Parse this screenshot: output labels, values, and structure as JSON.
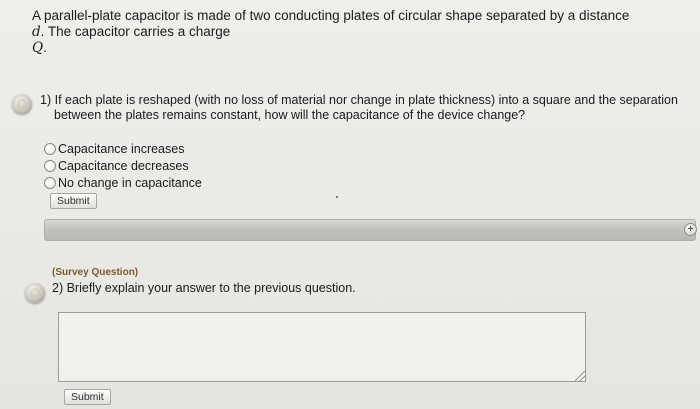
{
  "intro": {
    "line1": "A parallel-plate capacitor is made of two conducting plates of circular shape separated by a distance",
    "var_d": "d",
    "line2_rest": ". The capacitor carries a charge",
    "var_Q": "Q",
    "period": "."
  },
  "question1": {
    "number": "1)",
    "text_line1": "If each plate is reshaped (with no loss of material nor change in plate thickness) into a square and the separation",
    "text_line2": "between the plates remains constant, how will  the capacitance of the device change?",
    "options": [
      {
        "label": "Capacitance increases",
        "selected": false
      },
      {
        "label": "Capacitance decreases",
        "selected": false
      },
      {
        "label": "No change in capacitance",
        "selected": false
      }
    ],
    "submit_label": "Submit"
  },
  "question2": {
    "survey_tag": "(Survey Question)",
    "text": "2) Briefly explain your answer to the previous question.",
    "answer_value": "",
    "submit_label": "Submit"
  },
  "icons": {
    "question_status": "question-status-icon",
    "expand": "plus-circle-icon"
  }
}
